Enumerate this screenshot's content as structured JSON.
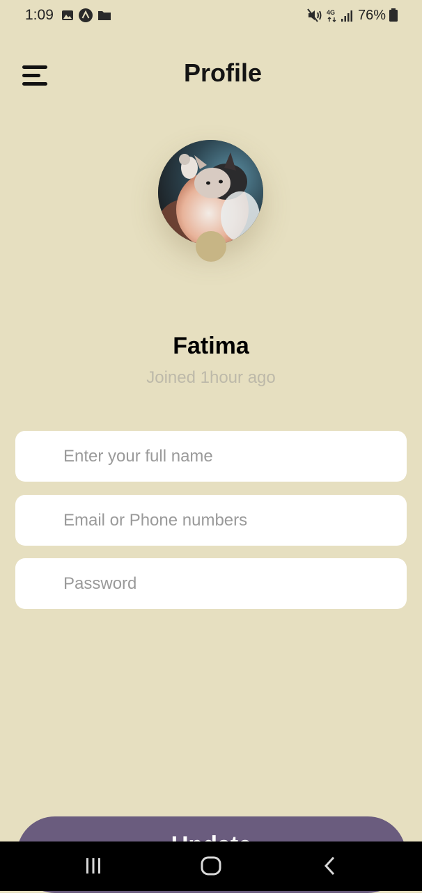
{
  "status_bar": {
    "time": "1:09",
    "network": "4G",
    "battery": "76%",
    "left_icons": [
      "image-icon",
      "app-alert-icon",
      "folder-icon"
    ],
    "right_icons": [
      "mute-icon",
      "network-4g-icon",
      "signal-icon",
      "battery-icon"
    ]
  },
  "header": {
    "title": "Profile",
    "menu_icon": "menu-icon"
  },
  "profile": {
    "name": "Fatima",
    "joined": "Joined 1hour ago",
    "avatar_alt": "cat photo"
  },
  "form": {
    "full_name": {
      "placeholder": "Enter your full name",
      "value": ""
    },
    "contact": {
      "placeholder": "Email or Phone numbers",
      "value": ""
    },
    "password": {
      "placeholder": "Password",
      "value": ""
    }
  },
  "update_button": {
    "label": "Update"
  },
  "nav_bar": {
    "recents_icon": "recents-icon",
    "home_icon": "home-icon",
    "back_icon": "back-icon"
  },
  "colors": {
    "background": "#e6dfc0",
    "accent": "#6a5c7e",
    "avatar_badge": "#c7b585",
    "muted_text": "#bdb9a9"
  }
}
